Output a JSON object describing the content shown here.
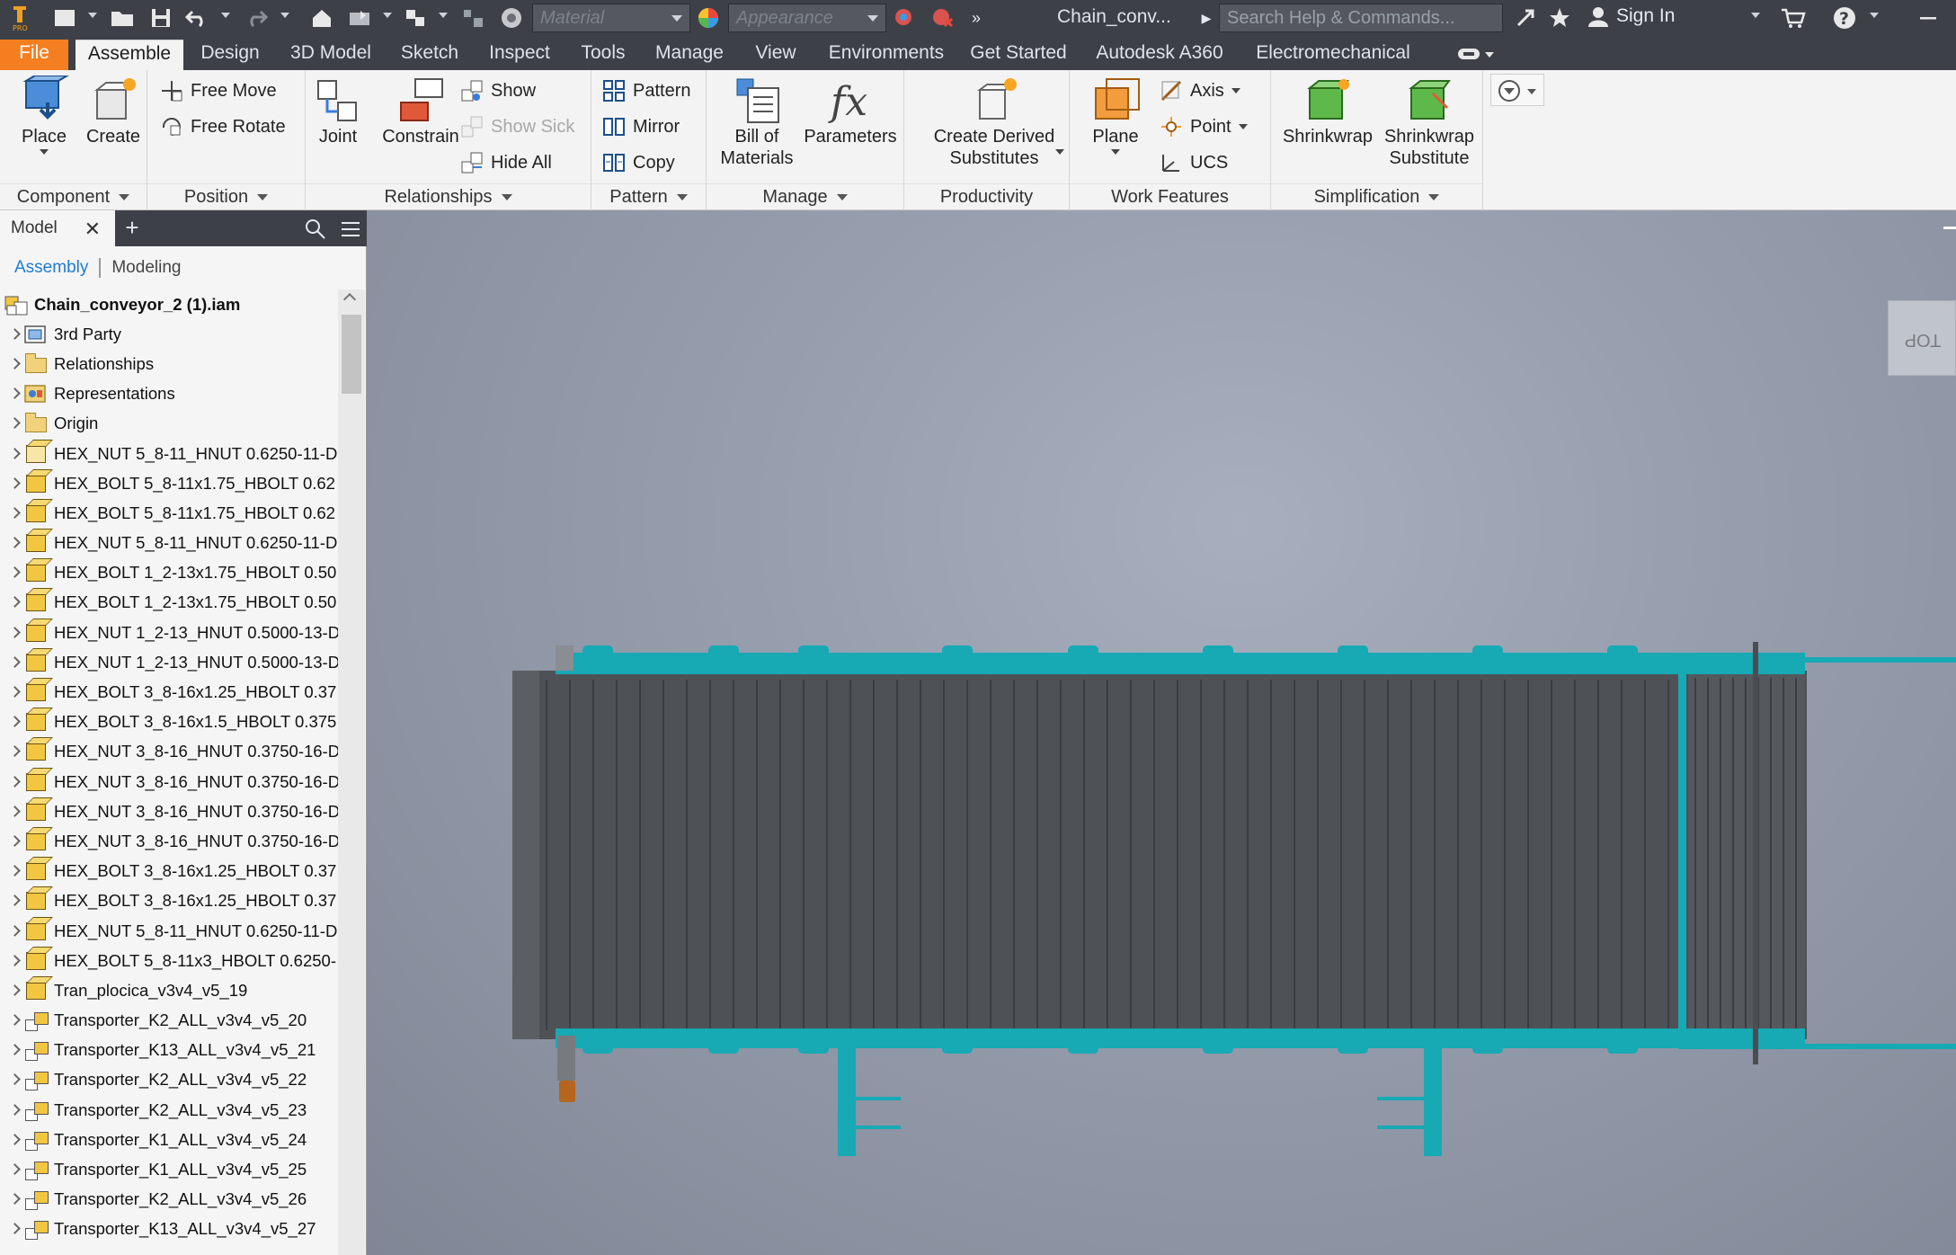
{
  "titlebar": {
    "material_placeholder": "Material",
    "appearance_placeholder": "Appearance",
    "doc_title": "Chain_conv...",
    "search_placeholder": "Search Help & Commands...",
    "sign_in": "Sign In"
  },
  "tabs": [
    {
      "label": "File"
    },
    {
      "label": "Assemble"
    },
    {
      "label": "Design"
    },
    {
      "label": "3D Model"
    },
    {
      "label": "Sketch"
    },
    {
      "label": "Inspect"
    },
    {
      "label": "Tools"
    },
    {
      "label": "Manage"
    },
    {
      "label": "View"
    },
    {
      "label": "Environments"
    },
    {
      "label": "Get Started"
    },
    {
      "label": "Autodesk A360"
    },
    {
      "label": "Electromechanical"
    }
  ],
  "ribbon": {
    "component": {
      "title": "Component",
      "place": "Place",
      "create": "Create"
    },
    "position": {
      "title": "Position",
      "free_move": "Free Move",
      "free_rotate": "Free Rotate"
    },
    "relationships": {
      "title": "Relationships",
      "joint": "Joint",
      "constrain": "Constrain",
      "show": "Show",
      "show_sick": "Show Sick",
      "hide_all": "Hide All"
    },
    "pattern": {
      "title": "Pattern",
      "pattern": "Pattern",
      "mirror": "Mirror",
      "copy": "Copy"
    },
    "manage": {
      "title": "Manage",
      "bom_line1": "Bill of",
      "bom_line2": "Materials",
      "parameters": "Parameters"
    },
    "productivity": {
      "title": "Productivity",
      "derived_line1": "Create Derived",
      "derived_line2": "Substitutes"
    },
    "work_features": {
      "title": "Work Features",
      "plane": "Plane",
      "axis": "Axis",
      "point": "Point",
      "ucs": "UCS"
    },
    "simplification": {
      "title": "Simplification",
      "shrinkwrap": "Shrinkwrap",
      "sws_line1": "Shrinkwrap",
      "sws_line2": "Substitute"
    }
  },
  "browser": {
    "tab_label": "Model",
    "mode_assembly": "Assembly",
    "mode_modeling": "Modeling",
    "root": "Chain_conveyor_2 (1).iam",
    "items": [
      {
        "label": "3rd Party",
        "icon": "third-party-icon"
      },
      {
        "label": "Relationships",
        "icon": "folder-icon"
      },
      {
        "label": "Representations",
        "icon": "representations-icon"
      },
      {
        "label": "Origin",
        "icon": "folder-icon"
      },
      {
        "label": "HEX_NUT 5_8-11_HNUT 0.6250-11-D",
        "icon": "content-center-part-icon"
      },
      {
        "label": "HEX_BOLT 5_8-11x1.75_HBOLT 0.62",
        "icon": "part-icon"
      },
      {
        "label": "HEX_BOLT 5_8-11x1.75_HBOLT 0.62",
        "icon": "part-icon"
      },
      {
        "label": "HEX_NUT 5_8-11_HNUT 0.6250-11-D",
        "icon": "part-icon"
      },
      {
        "label": "HEX_BOLT 1_2-13x1.75_HBOLT 0.50",
        "icon": "part-icon"
      },
      {
        "label": "HEX_BOLT 1_2-13x1.75_HBOLT 0.50",
        "icon": "part-icon"
      },
      {
        "label": "HEX_NUT 1_2-13_HNUT 0.5000-13-D",
        "icon": "part-icon"
      },
      {
        "label": "HEX_NUT 1_2-13_HNUT 0.5000-13-D",
        "icon": "part-icon"
      },
      {
        "label": "HEX_BOLT 3_8-16x1.25_HBOLT 0.37",
        "icon": "part-icon"
      },
      {
        "label": "HEX_BOLT 3_8-16x1.5_HBOLT 0.375",
        "icon": "part-icon"
      },
      {
        "label": "HEX_NUT 3_8-16_HNUT 0.3750-16-D",
        "icon": "part-icon"
      },
      {
        "label": "HEX_NUT 3_8-16_HNUT 0.3750-16-D",
        "icon": "part-icon"
      },
      {
        "label": "HEX_NUT 3_8-16_HNUT 0.3750-16-D",
        "icon": "part-icon"
      },
      {
        "label": "HEX_NUT 3_8-16_HNUT 0.3750-16-D",
        "icon": "part-icon"
      },
      {
        "label": "HEX_BOLT 3_8-16x1.25_HBOLT 0.37",
        "icon": "part-icon"
      },
      {
        "label": "HEX_BOLT 3_8-16x1.25_HBOLT 0.37",
        "icon": "part-icon"
      },
      {
        "label": "HEX_NUT 5_8-11_HNUT 0.6250-11-D",
        "icon": "part-icon"
      },
      {
        "label": "HEX_BOLT 5_8-11x3_HBOLT 0.6250-",
        "icon": "part-icon"
      },
      {
        "label": "Tran_plocica_v3v4_v5_19",
        "icon": "part-icon"
      },
      {
        "label": "Transporter_K2_ALL_v3v4_v5_20",
        "icon": "subassembly-icon"
      },
      {
        "label": "Transporter_K13_ALL_v3v4_v5_21",
        "icon": "subassembly-icon"
      },
      {
        "label": "Transporter_K2_ALL_v3v4_v5_22",
        "icon": "subassembly-icon"
      },
      {
        "label": "Transporter_K2_ALL_v3v4_v5_23",
        "icon": "subassembly-icon"
      },
      {
        "label": "Transporter_K1_ALL_v3v4_v5_24",
        "icon": "subassembly-icon"
      },
      {
        "label": "Transporter_K1_ALL_v3v4_v5_25",
        "icon": "subassembly-icon"
      },
      {
        "label": "Transporter_K2_ALL_v3v4_v5_26",
        "icon": "subassembly-icon"
      },
      {
        "label": "Transporter_K13_ALL_v3v4_v5_27",
        "icon": "subassembly-icon"
      }
    ]
  },
  "viewport": {
    "viewcube_face": "TOP",
    "frame_color": "#17a9b4",
    "chain_color": "#4e5156",
    "background_top": "#a7afbe",
    "background_bottom": "#7f8695"
  }
}
